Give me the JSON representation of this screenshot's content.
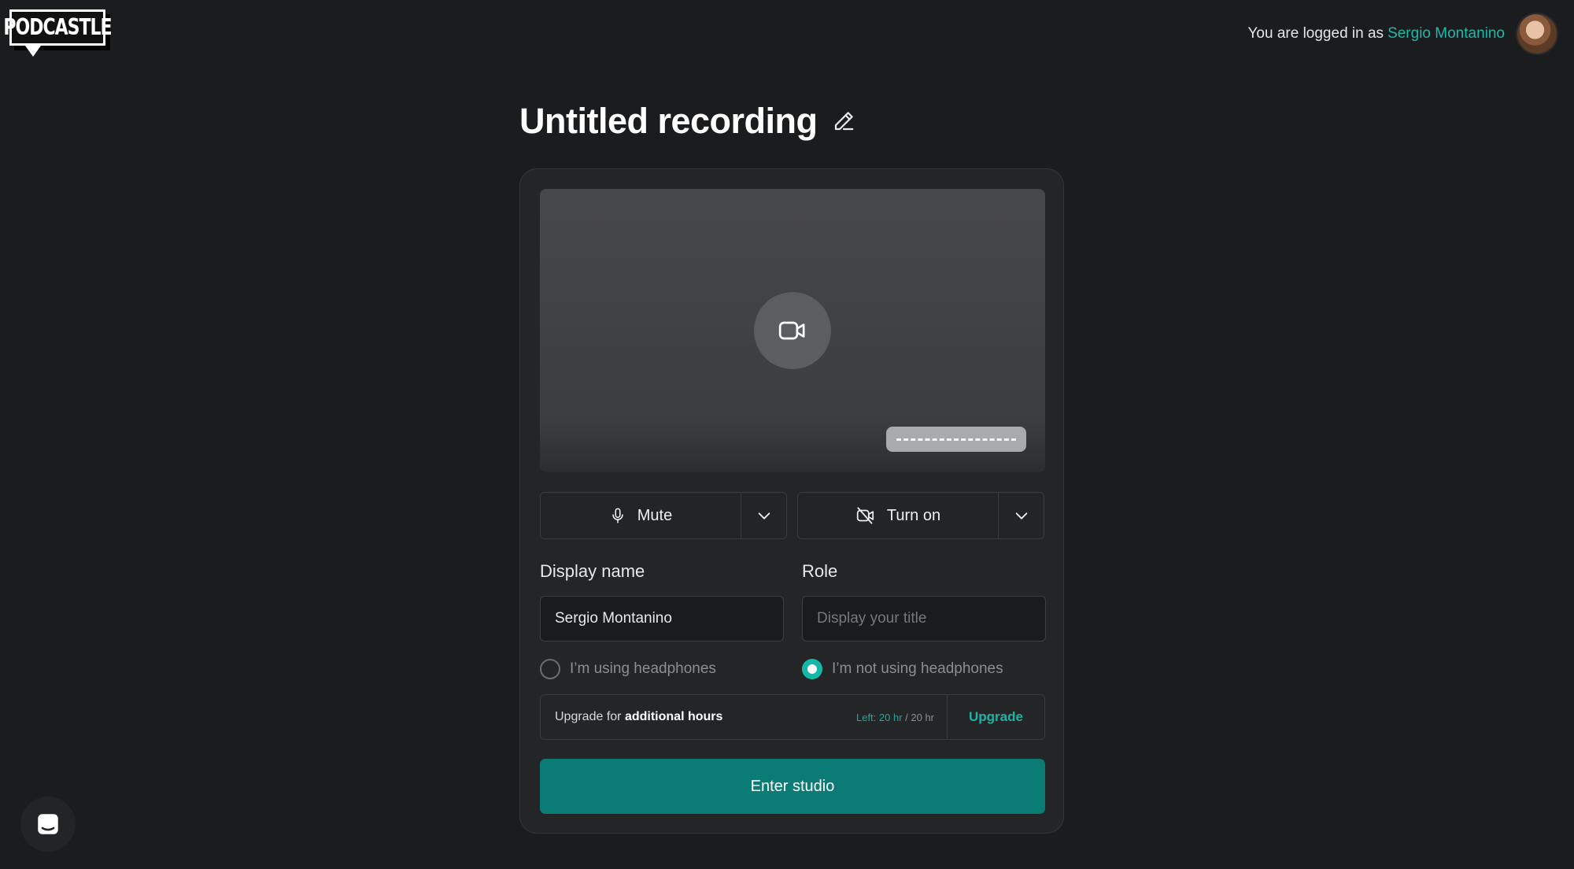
{
  "brand": {
    "logo_text": "PODCASTLE"
  },
  "header": {
    "logged_in_prefix": "You are logged in as",
    "user_name": "Sergio Montanino"
  },
  "recording": {
    "title": "Untitled recording"
  },
  "devices": {
    "mic_label": "Mute",
    "camera_label": "Turn on"
  },
  "form": {
    "display_name_label": "Display name",
    "display_name_value": "Sergio Montanino",
    "role_label": "Role",
    "role_placeholder": "Display your title",
    "headphones_option": "I’m using headphones",
    "no_headphones_option": "I’m not using headphones",
    "selected_option": "no_headphones"
  },
  "upgrade": {
    "prefix": "Upgrade for",
    "emphasis": "additional hours",
    "left_label": "Left: 20 hr",
    "total_label": " / 20 hr",
    "button_label": "Upgrade"
  },
  "actions": {
    "enter_label": "Enter studio"
  },
  "colors": {
    "accent": "#1fb3a4",
    "primary_button": "#0b7b76",
    "background": "#1b1c1e"
  }
}
